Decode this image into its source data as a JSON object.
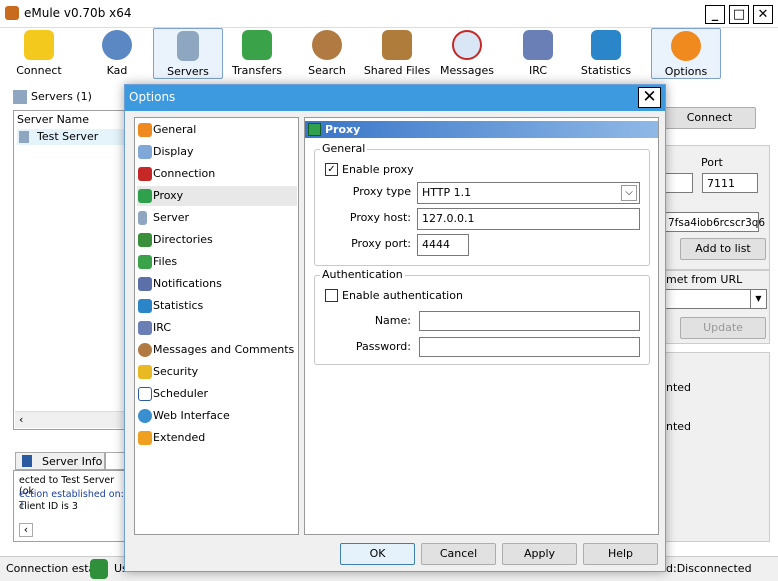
{
  "window": {
    "title": "eMule v0.70b x64"
  },
  "toolbar": {
    "buttons": [
      "Connect",
      "Kad",
      "Servers",
      "Transfers",
      "Search",
      "Shared Files",
      "Messages",
      "IRC",
      "Statistics",
      "Options"
    ]
  },
  "left_panel": {
    "servers_label": "Servers (1)",
    "col_server_name": "Server Name",
    "server_row": "Test Server",
    "tab_server_info": "Server Info",
    "log_lines": [
      "ected to Test Server (ok",
      "ection established on: T",
      "client ID is 3"
    ]
  },
  "right_panel": {
    "connect_button": "Connect",
    "port_label": "Port",
    "port_value": "7111",
    "hash_value": "7fsa4iob6rcscr3q6",
    "add_to_list": "Add to list",
    "met_from_url": "met from URL",
    "update_button": "Update",
    "text1": "nted",
    "text2": "nted"
  },
  "status": {
    "left": "Connection esta",
    "mid": "Us",
    "right": "d:Disconnected"
  },
  "dialog": {
    "title": "Options",
    "nav": [
      "General",
      "Display",
      "Connection",
      "Proxy",
      "Server",
      "Directories",
      "Files",
      "Notifications",
      "Statistics",
      "IRC",
      "Messages and Comments",
      "Security",
      "Scheduler",
      "Web Interface",
      "Extended"
    ],
    "page_title": "Proxy",
    "general_group": "General",
    "enable_proxy": "Enable proxy",
    "proxy_type_label": "Proxy type",
    "proxy_type_value": "HTTP 1.1",
    "proxy_host_label": "Proxy host:",
    "proxy_host_value": "127.0.0.1",
    "proxy_port_label": "Proxy port:",
    "proxy_port_value": "4444",
    "auth_group": "Authentication",
    "enable_auth": "Enable authentication",
    "name_label": "Name:",
    "password_label": "Password:",
    "ok": "OK",
    "cancel": "Cancel",
    "apply": "Apply",
    "help": "Help"
  }
}
